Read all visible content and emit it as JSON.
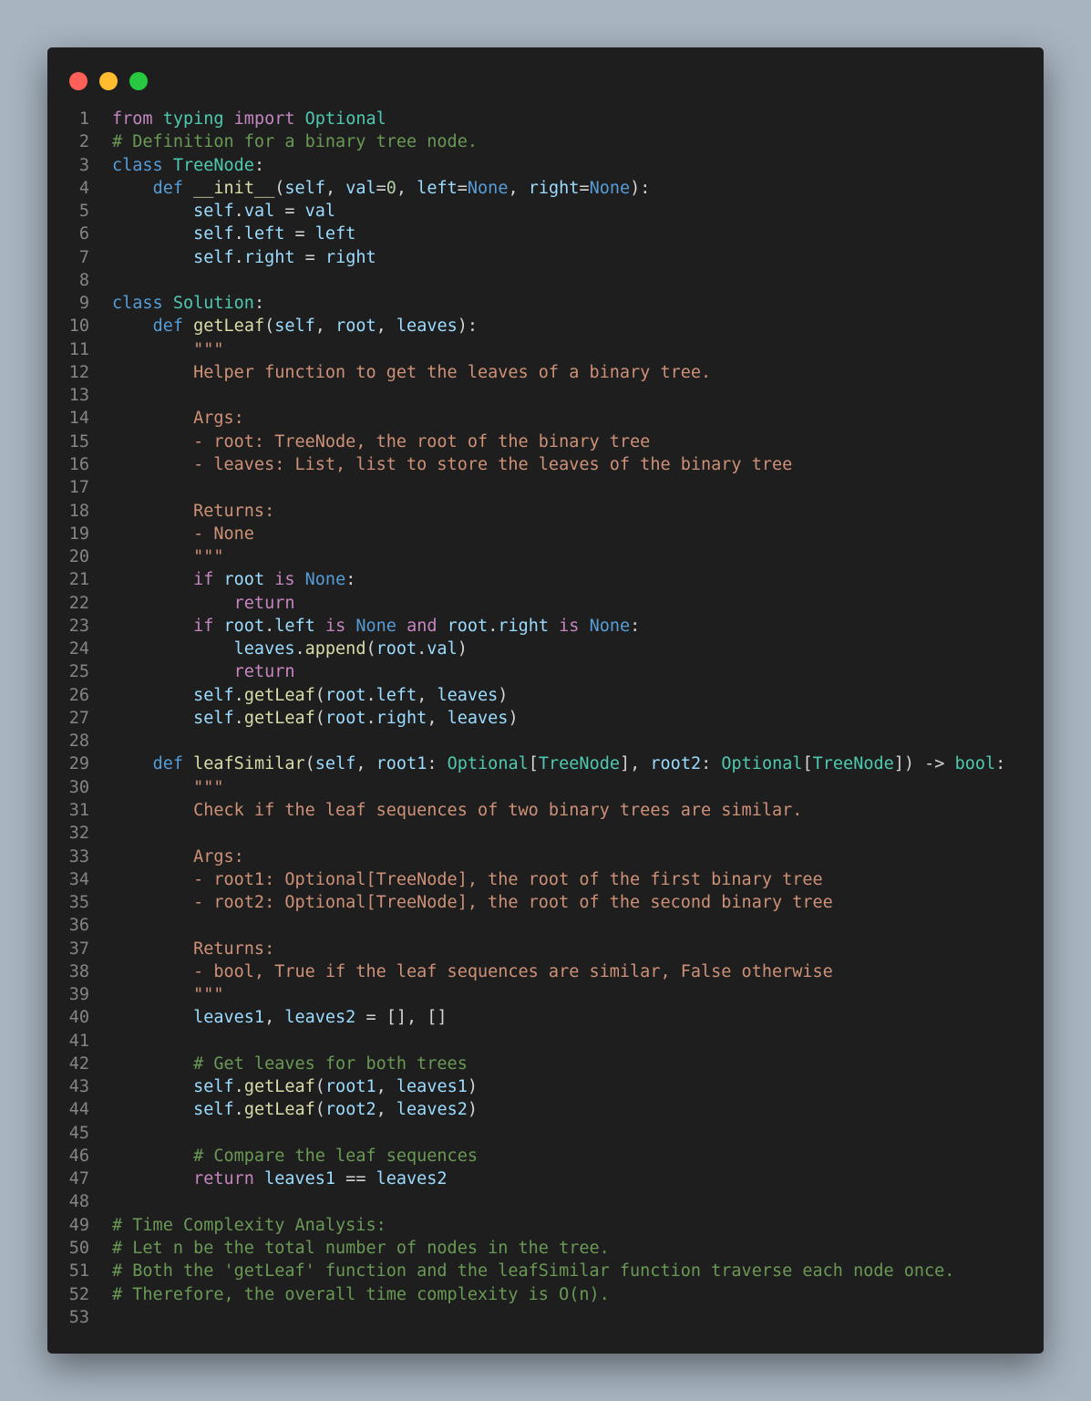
{
  "window": {
    "controls": [
      {
        "name": "close",
        "color": "#ff5f57"
      },
      {
        "name": "minimize",
        "color": "#febc2e"
      },
      {
        "name": "maximize",
        "color": "#28c840"
      }
    ]
  },
  "editor": {
    "language": "python",
    "lines": [
      [
        [
          "k",
          "from"
        ],
        [
          "p",
          " "
        ],
        [
          "t",
          "typing"
        ],
        [
          "p",
          " "
        ],
        [
          "k",
          "import"
        ],
        [
          "p",
          " "
        ],
        [
          "t",
          "Optional"
        ]
      ],
      [
        [
          "c",
          "# Definition for a binary tree node."
        ]
      ],
      [
        [
          "kb",
          "class"
        ],
        [
          "p",
          " "
        ],
        [
          "t",
          "TreeNode"
        ],
        [
          "p",
          ":"
        ]
      ],
      [
        [
          "p",
          "    "
        ],
        [
          "kb",
          "def"
        ],
        [
          "p",
          " "
        ],
        [
          "f",
          "__init__"
        ],
        [
          "p",
          "("
        ],
        [
          "v",
          "self"
        ],
        [
          "p",
          ", "
        ],
        [
          "v",
          "val"
        ],
        [
          "p",
          "="
        ],
        [
          "n",
          "0"
        ],
        [
          "p",
          ", "
        ],
        [
          "v",
          "left"
        ],
        [
          "p",
          "="
        ],
        [
          "kb",
          "None"
        ],
        [
          "p",
          ", "
        ],
        [
          "v",
          "right"
        ],
        [
          "p",
          "="
        ],
        [
          "kb",
          "None"
        ],
        [
          "p",
          "):"
        ]
      ],
      [
        [
          "p",
          "        "
        ],
        [
          "v",
          "self"
        ],
        [
          "p",
          "."
        ],
        [
          "v",
          "val"
        ],
        [
          "p",
          " = "
        ],
        [
          "v",
          "val"
        ]
      ],
      [
        [
          "p",
          "        "
        ],
        [
          "v",
          "self"
        ],
        [
          "p",
          "."
        ],
        [
          "v",
          "left"
        ],
        [
          "p",
          " = "
        ],
        [
          "v",
          "left"
        ]
      ],
      [
        [
          "p",
          "        "
        ],
        [
          "v",
          "self"
        ],
        [
          "p",
          "."
        ],
        [
          "v",
          "right"
        ],
        [
          "p",
          " = "
        ],
        [
          "v",
          "right"
        ]
      ],
      [],
      [
        [
          "kb",
          "class"
        ],
        [
          "p",
          " "
        ],
        [
          "t",
          "Solution"
        ],
        [
          "p",
          ":"
        ]
      ],
      [
        [
          "p",
          "    "
        ],
        [
          "kb",
          "def"
        ],
        [
          "p",
          " "
        ],
        [
          "f",
          "getLeaf"
        ],
        [
          "p",
          "("
        ],
        [
          "v",
          "self"
        ],
        [
          "p",
          ", "
        ],
        [
          "v",
          "root"
        ],
        [
          "p",
          ", "
        ],
        [
          "v",
          "leaves"
        ],
        [
          "p",
          "):"
        ]
      ],
      [
        [
          "p",
          "        "
        ],
        [
          "s",
          "\"\"\""
        ]
      ],
      [
        [
          "p",
          "        "
        ],
        [
          "s",
          "Helper function to get the leaves of a binary tree."
        ]
      ],
      [],
      [
        [
          "p",
          "        "
        ],
        [
          "s",
          "Args:"
        ]
      ],
      [
        [
          "p",
          "        "
        ],
        [
          "s",
          "- root: TreeNode, the root of the binary tree"
        ]
      ],
      [
        [
          "p",
          "        "
        ],
        [
          "s",
          "- leaves: List, list to store the leaves of the binary tree"
        ]
      ],
      [],
      [
        [
          "p",
          "        "
        ],
        [
          "s",
          "Returns:"
        ]
      ],
      [
        [
          "p",
          "        "
        ],
        [
          "s",
          "- None"
        ]
      ],
      [
        [
          "p",
          "        "
        ],
        [
          "s",
          "\"\"\""
        ]
      ],
      [
        [
          "p",
          "        "
        ],
        [
          "k",
          "if"
        ],
        [
          "p",
          " "
        ],
        [
          "v",
          "root"
        ],
        [
          "p",
          " "
        ],
        [
          "k",
          "is"
        ],
        [
          "p",
          " "
        ],
        [
          "kb",
          "None"
        ],
        [
          "p",
          ":"
        ]
      ],
      [
        [
          "p",
          "            "
        ],
        [
          "k",
          "return"
        ]
      ],
      [
        [
          "p",
          "        "
        ],
        [
          "k",
          "if"
        ],
        [
          "p",
          " "
        ],
        [
          "v",
          "root"
        ],
        [
          "p",
          "."
        ],
        [
          "v",
          "left"
        ],
        [
          "p",
          " "
        ],
        [
          "k",
          "is"
        ],
        [
          "p",
          " "
        ],
        [
          "kb",
          "None"
        ],
        [
          "p",
          " "
        ],
        [
          "k",
          "and"
        ],
        [
          "p",
          " "
        ],
        [
          "v",
          "root"
        ],
        [
          "p",
          "."
        ],
        [
          "v",
          "right"
        ],
        [
          "p",
          " "
        ],
        [
          "k",
          "is"
        ],
        [
          "p",
          " "
        ],
        [
          "kb",
          "None"
        ],
        [
          "p",
          ":"
        ]
      ],
      [
        [
          "p",
          "            "
        ],
        [
          "v",
          "leaves"
        ],
        [
          "p",
          "."
        ],
        [
          "f",
          "append"
        ],
        [
          "p",
          "("
        ],
        [
          "v",
          "root"
        ],
        [
          "p",
          "."
        ],
        [
          "v",
          "val"
        ],
        [
          "p",
          ")"
        ]
      ],
      [
        [
          "p",
          "            "
        ],
        [
          "k",
          "return"
        ]
      ],
      [
        [
          "p",
          "        "
        ],
        [
          "v",
          "self"
        ],
        [
          "p",
          "."
        ],
        [
          "f",
          "getLeaf"
        ],
        [
          "p",
          "("
        ],
        [
          "v",
          "root"
        ],
        [
          "p",
          "."
        ],
        [
          "v",
          "left"
        ],
        [
          "p",
          ", "
        ],
        [
          "v",
          "leaves"
        ],
        [
          "p",
          ")"
        ]
      ],
      [
        [
          "p",
          "        "
        ],
        [
          "v",
          "self"
        ],
        [
          "p",
          "."
        ],
        [
          "f",
          "getLeaf"
        ],
        [
          "p",
          "("
        ],
        [
          "v",
          "root"
        ],
        [
          "p",
          "."
        ],
        [
          "v",
          "right"
        ],
        [
          "p",
          ", "
        ],
        [
          "v",
          "leaves"
        ],
        [
          "p",
          ")"
        ]
      ],
      [],
      [
        [
          "p",
          "    "
        ],
        [
          "kb",
          "def"
        ],
        [
          "p",
          " "
        ],
        [
          "f",
          "leafSimilar"
        ],
        [
          "p",
          "("
        ],
        [
          "v",
          "self"
        ],
        [
          "p",
          ", "
        ],
        [
          "v",
          "root1"
        ],
        [
          "p",
          ": "
        ],
        [
          "t",
          "Optional"
        ],
        [
          "p",
          "["
        ],
        [
          "t",
          "TreeNode"
        ],
        [
          "p",
          "], "
        ],
        [
          "v",
          "root2"
        ],
        [
          "p",
          ": "
        ],
        [
          "t",
          "Optional"
        ],
        [
          "p",
          "["
        ],
        [
          "t",
          "TreeNode"
        ],
        [
          "p",
          "]) -> "
        ],
        [
          "t",
          "bool"
        ],
        [
          "p",
          ":"
        ]
      ],
      [
        [
          "p",
          "        "
        ],
        [
          "s",
          "\"\"\""
        ]
      ],
      [
        [
          "p",
          "        "
        ],
        [
          "s",
          "Check if the leaf sequences of two binary trees are similar."
        ]
      ],
      [],
      [
        [
          "p",
          "        "
        ],
        [
          "s",
          "Args:"
        ]
      ],
      [
        [
          "p",
          "        "
        ],
        [
          "s",
          "- root1: Optional[TreeNode], the root of the first binary tree"
        ]
      ],
      [
        [
          "p",
          "        "
        ],
        [
          "s",
          "- root2: Optional[TreeNode], the root of the second binary tree"
        ]
      ],
      [],
      [
        [
          "p",
          "        "
        ],
        [
          "s",
          "Returns:"
        ]
      ],
      [
        [
          "p",
          "        "
        ],
        [
          "s",
          "- bool, True if the leaf sequences are similar, False otherwise"
        ]
      ],
      [
        [
          "p",
          "        "
        ],
        [
          "s",
          "\"\"\""
        ]
      ],
      [
        [
          "p",
          "        "
        ],
        [
          "v",
          "leaves1"
        ],
        [
          "p",
          ", "
        ],
        [
          "v",
          "leaves2"
        ],
        [
          "p",
          " = [], []"
        ]
      ],
      [],
      [
        [
          "p",
          "        "
        ],
        [
          "c",
          "# Get leaves for both trees"
        ]
      ],
      [
        [
          "p",
          "        "
        ],
        [
          "v",
          "self"
        ],
        [
          "p",
          "."
        ],
        [
          "f",
          "getLeaf"
        ],
        [
          "p",
          "("
        ],
        [
          "v",
          "root1"
        ],
        [
          "p",
          ", "
        ],
        [
          "v",
          "leaves1"
        ],
        [
          "p",
          ")"
        ]
      ],
      [
        [
          "p",
          "        "
        ],
        [
          "v",
          "self"
        ],
        [
          "p",
          "."
        ],
        [
          "f",
          "getLeaf"
        ],
        [
          "p",
          "("
        ],
        [
          "v",
          "root2"
        ],
        [
          "p",
          ", "
        ],
        [
          "v",
          "leaves2"
        ],
        [
          "p",
          ")"
        ]
      ],
      [],
      [
        [
          "p",
          "        "
        ],
        [
          "c",
          "# Compare the leaf sequences"
        ]
      ],
      [
        [
          "p",
          "        "
        ],
        [
          "k",
          "return"
        ],
        [
          "p",
          " "
        ],
        [
          "v",
          "leaves1"
        ],
        [
          "p",
          " == "
        ],
        [
          "v",
          "leaves2"
        ]
      ],
      [],
      [
        [
          "c",
          "# Time Complexity Analysis:"
        ]
      ],
      [
        [
          "c",
          "# Let n be the total number of nodes in the tree."
        ]
      ],
      [
        [
          "c",
          "# Both the 'getLeaf' function and the leafSimilar function traverse each node once."
        ]
      ],
      [
        [
          "c",
          "# Therefore, the overall time complexity is O(n)."
        ]
      ],
      []
    ]
  }
}
